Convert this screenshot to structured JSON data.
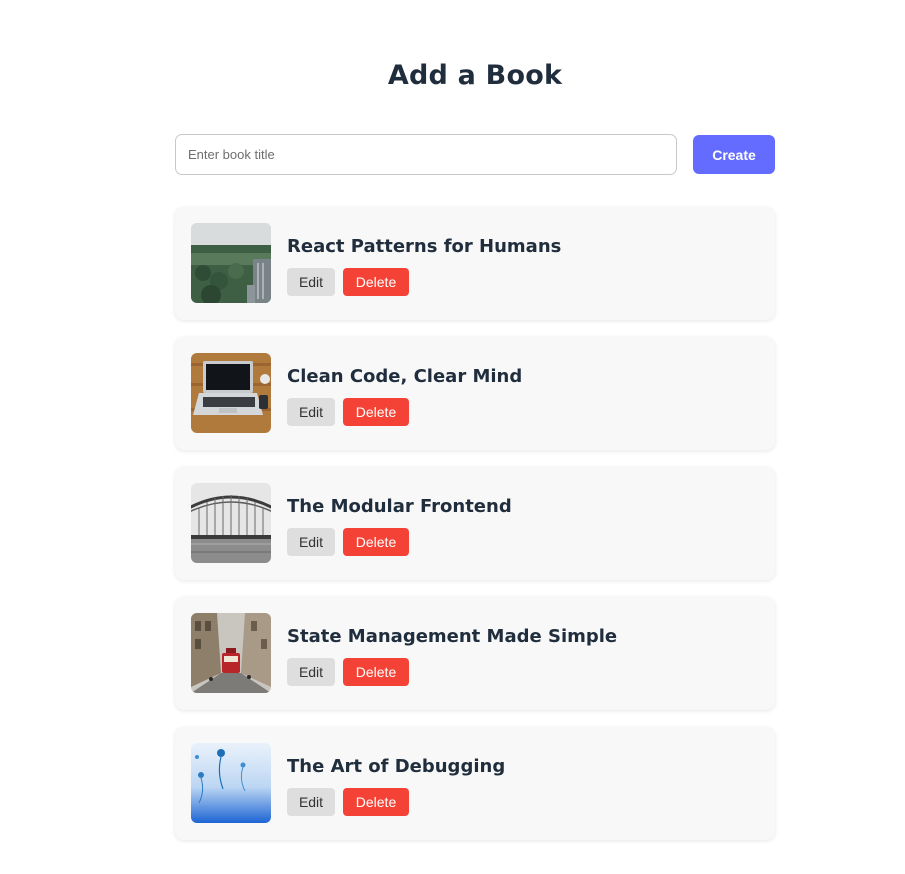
{
  "header": {
    "title": "Add a Book"
  },
  "create_form": {
    "input_value": "",
    "input_placeholder": "Enter book title",
    "create_label": "Create"
  },
  "books": [
    {
      "title": "React Patterns for Humans",
      "edit_label": "Edit",
      "delete_label": "Delete",
      "cover": "city-park-photo"
    },
    {
      "title": "Clean Code, Clear Mind",
      "edit_label": "Edit",
      "delete_label": "Delete",
      "cover": "laptop-desk-photo"
    },
    {
      "title": "The Modular Frontend",
      "edit_label": "Edit",
      "delete_label": "Delete",
      "cover": "bridge-arch-photo"
    },
    {
      "title": "State Management Made Simple",
      "edit_label": "Edit",
      "delete_label": "Delete",
      "cover": "tram-street-photo"
    },
    {
      "title": "The Art of Debugging",
      "edit_label": "Edit",
      "delete_label": "Delete",
      "cover": "blue-jellyfish-photo"
    }
  ],
  "colors": {
    "accent": "#646cff",
    "danger": "#f44336",
    "edit_bg": "#dedede",
    "card_bg": "#f8f8f8",
    "text": "#1f2d3d"
  }
}
